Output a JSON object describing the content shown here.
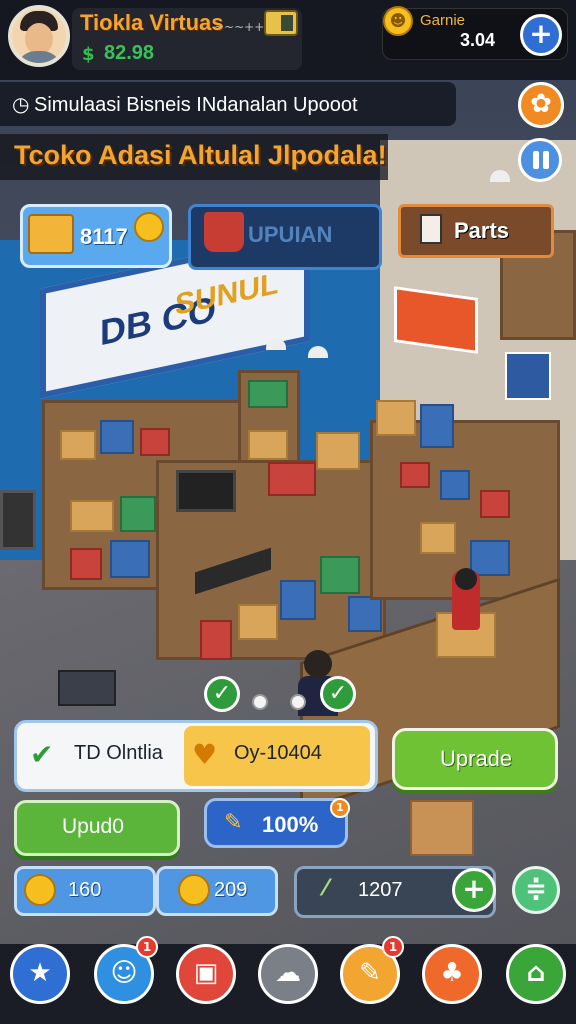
{
  "player": {
    "name": "Tiokla Virtuas",
    "name_deco": "~~~+++",
    "money": "82.98",
    "money_icon": "cash-icon"
  },
  "currency": {
    "label": "Garnie",
    "value": "3.04"
  },
  "info_bar": {
    "text": "Simulaasi Bisneis INdanalan Upooot"
  },
  "title": {
    "text": "Tcoko Adasi Altulal Jlpodala!"
  },
  "store_sign": {
    "line1": "DB CO",
    "line2": "SUNUL"
  },
  "chips": {
    "inventory_value": "8117",
    "dark_chip_text": "UPUIAN",
    "parts_label": "Parts"
  },
  "actions": {
    "status_label": "TD Olntlia",
    "reward_text": "Oy-10404",
    "upgrade_label": "Uprade",
    "update_label": "Upud0",
    "progress_value": "100%",
    "progress_badge": "1"
  },
  "resources": {
    "res1_value": "160",
    "res2_value": "209",
    "tool_value": "1207"
  },
  "bottom_nav": {
    "items": [
      {
        "icon": "star-icon",
        "glyph": "★",
        "color": "#2f6fd4"
      },
      {
        "icon": "chef-icon",
        "glyph": "☺",
        "color": "#2f8fe0",
        "badge": "1"
      },
      {
        "icon": "register-icon",
        "glyph": "▣",
        "color": "#e0473a"
      },
      {
        "icon": "chat-icon",
        "glyph": "☁",
        "color": "#7a7f88"
      },
      {
        "icon": "hammer-icon",
        "glyph": "✎",
        "color": "#f2a531",
        "badge": "1"
      },
      {
        "icon": "people-icon",
        "glyph": "♣",
        "color": "#ef6a2a"
      },
      {
        "icon": "shop-icon",
        "glyph": "⌂",
        "color": "#3aa63a"
      }
    ]
  },
  "colors": {
    "accent_orange": "#f2a531",
    "money_green": "#37c25a",
    "primary_blue": "#2f6fd4",
    "upgrade_green": "#6fc234"
  }
}
